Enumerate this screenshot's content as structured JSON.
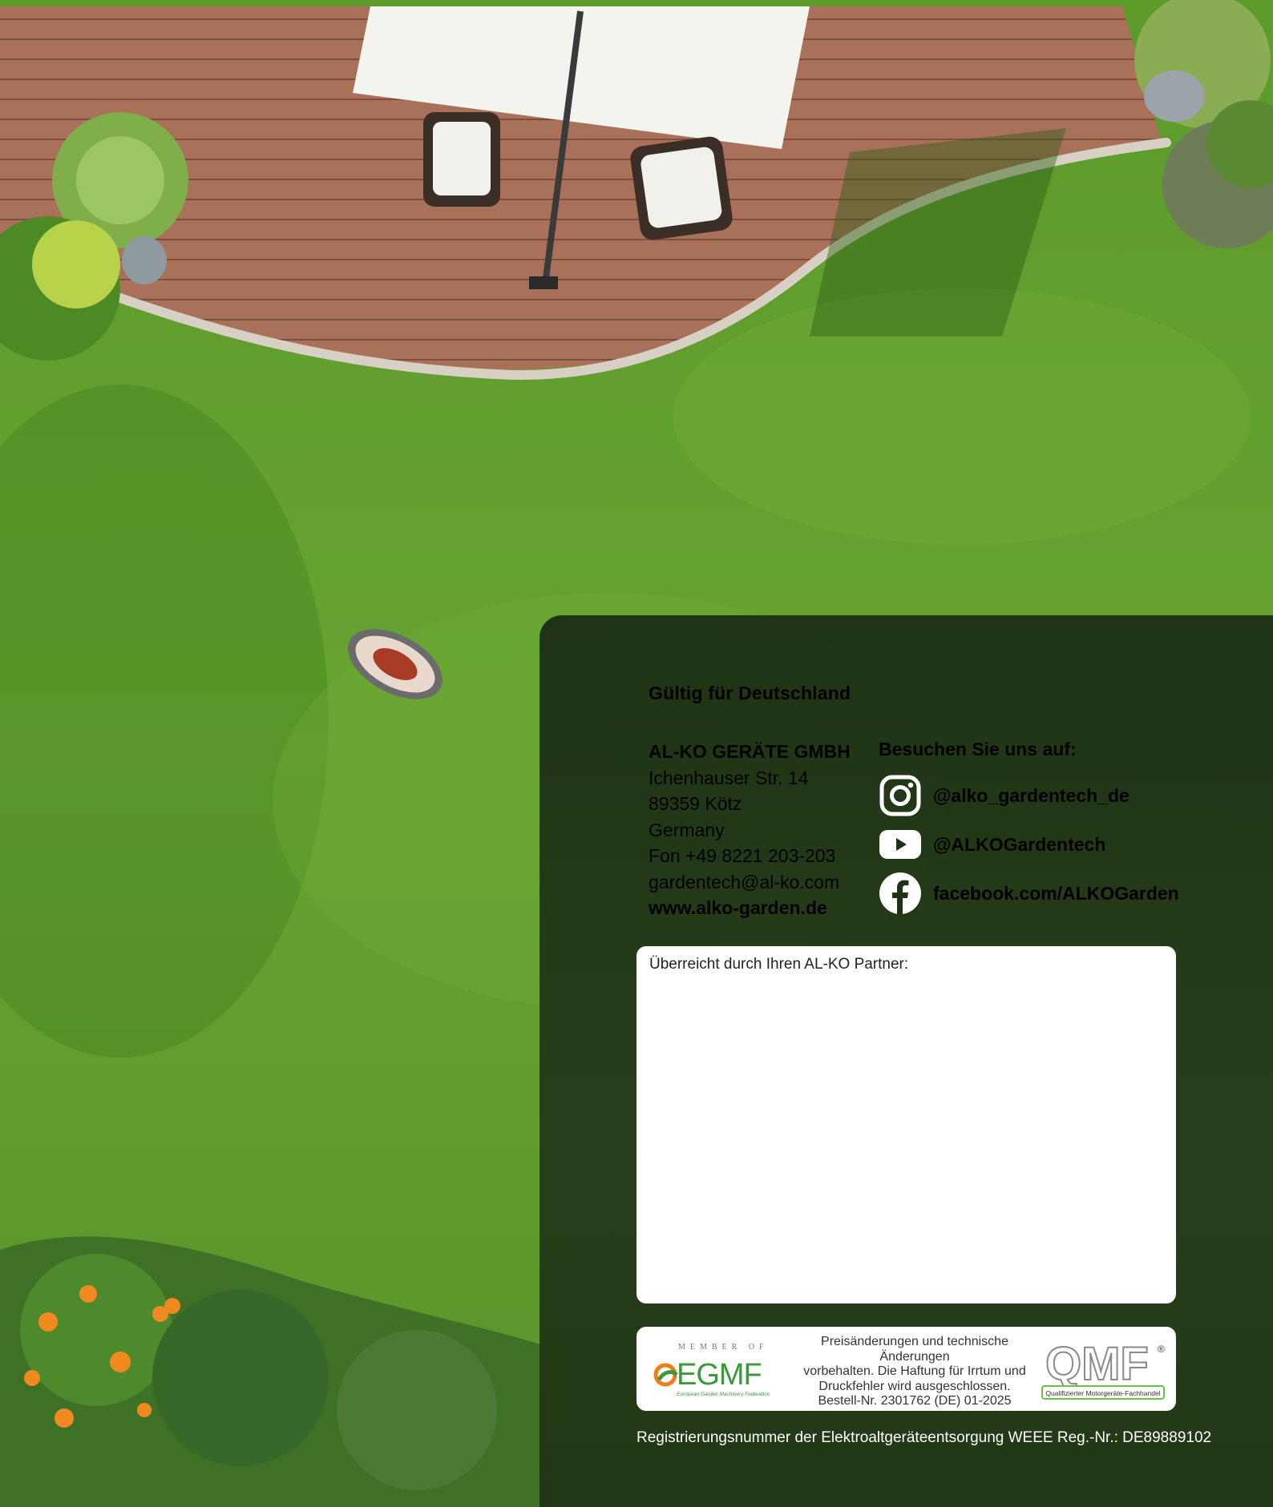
{
  "colors": {
    "lawn": "#5f9a2c",
    "deck": "#a7705a",
    "panel": "#1e3216",
    "white": "#ffffff",
    "egmf_green": "#3a9a3a",
    "egmf_orange": "#f07d1a",
    "qmf_green": "#6cc04a"
  },
  "validity": "Gültig für Deutschland",
  "company": {
    "name": "AL-KO GERÄTE GMBH",
    "street": "Ichenhauser Str. 14",
    "city": "89359 Kötz",
    "country": "Germany",
    "phone": "Fon +49 8221 203-203",
    "email": "gardentech@al-ko.com",
    "website": "www.alko-garden.de"
  },
  "social": {
    "heading": "Besuchen Sie uns auf:",
    "items": [
      {
        "icon": "instagram-icon",
        "label": "@alko_gardentech_de"
      },
      {
        "icon": "youtube-icon",
        "label": "@ALKOGardentech"
      },
      {
        "icon": "facebook-icon",
        "label": "facebook.com/ALKOGarden"
      }
    ]
  },
  "partner": {
    "label": "Überreicht durch Ihren AL-KO Partner:"
  },
  "legal": {
    "egmf_member": "MEMBER OF",
    "egmf_name": "EGMF",
    "egmf_tagline": "European Garden Machinery Federation",
    "lines": [
      "Preisänderungen und technische Änderungen",
      "vorbehalten. Die Haftung für Irrtum und",
      "Druckfehler wird ausgeschlossen.",
      "Bestell-Nr. 2301762 (DE) 01-2025"
    ],
    "qmf_name": "QMF",
    "qmf_tagline": "Qualifizierter Motorgeräte-Fachhandel"
  },
  "weee": "Registrierungsnummer der Elektroaltgeräteentsorgung WEEE Reg.-Nr.: DE89889102"
}
